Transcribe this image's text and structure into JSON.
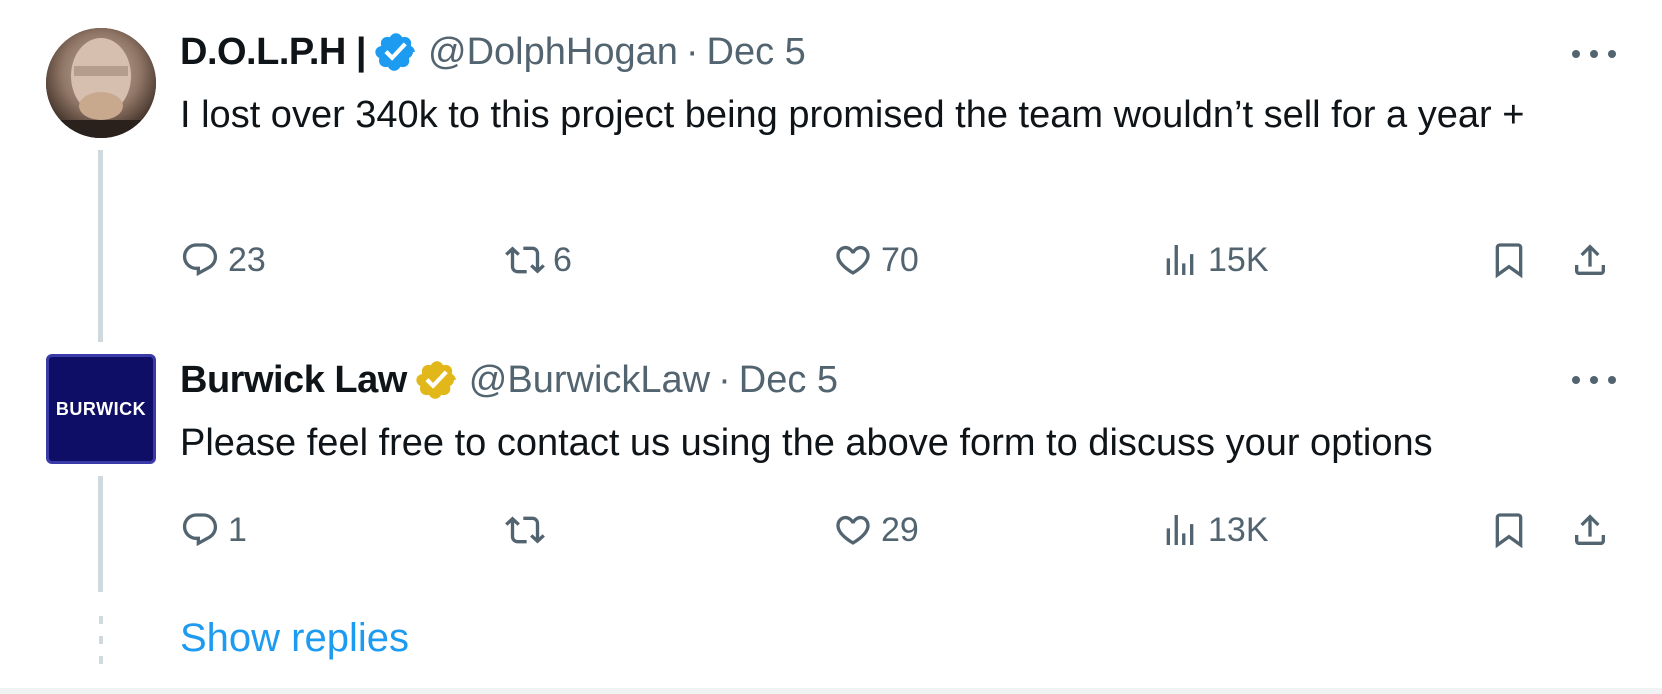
{
  "tweets": [
    {
      "display_name": "D.O.L.P.H |",
      "handle": "@DolphHogan",
      "separator": "·",
      "date": "Dec 5",
      "badge": "blue-verified-icon",
      "text": "I lost over 340k to this project being promised the team wouldn’t sell for a year +",
      "reply_count": "23",
      "retweet_count": "6",
      "like_count": "70",
      "view_count": "15K"
    },
    {
      "display_name": "Burwick Law",
      "handle": "@BurwickLaw",
      "separator": "·",
      "date": "Dec 5",
      "badge": "gold-verified-icon",
      "avatar_text": "BURWICK",
      "text": "Please feel free to contact us using the above form to discuss your options",
      "reply_count": "1",
      "retweet_count": "",
      "like_count": "29",
      "view_count": "13K"
    }
  ],
  "show_replies_label": "Show replies",
  "colors": {
    "text": "#0f1419",
    "muted": "#536471",
    "link": "#1d9bf0",
    "verified_blue": "#1d9bf0",
    "verified_gold": "#e2b719",
    "thread_line": "#cfd9de",
    "avatar_navy": "#0e0e66"
  }
}
